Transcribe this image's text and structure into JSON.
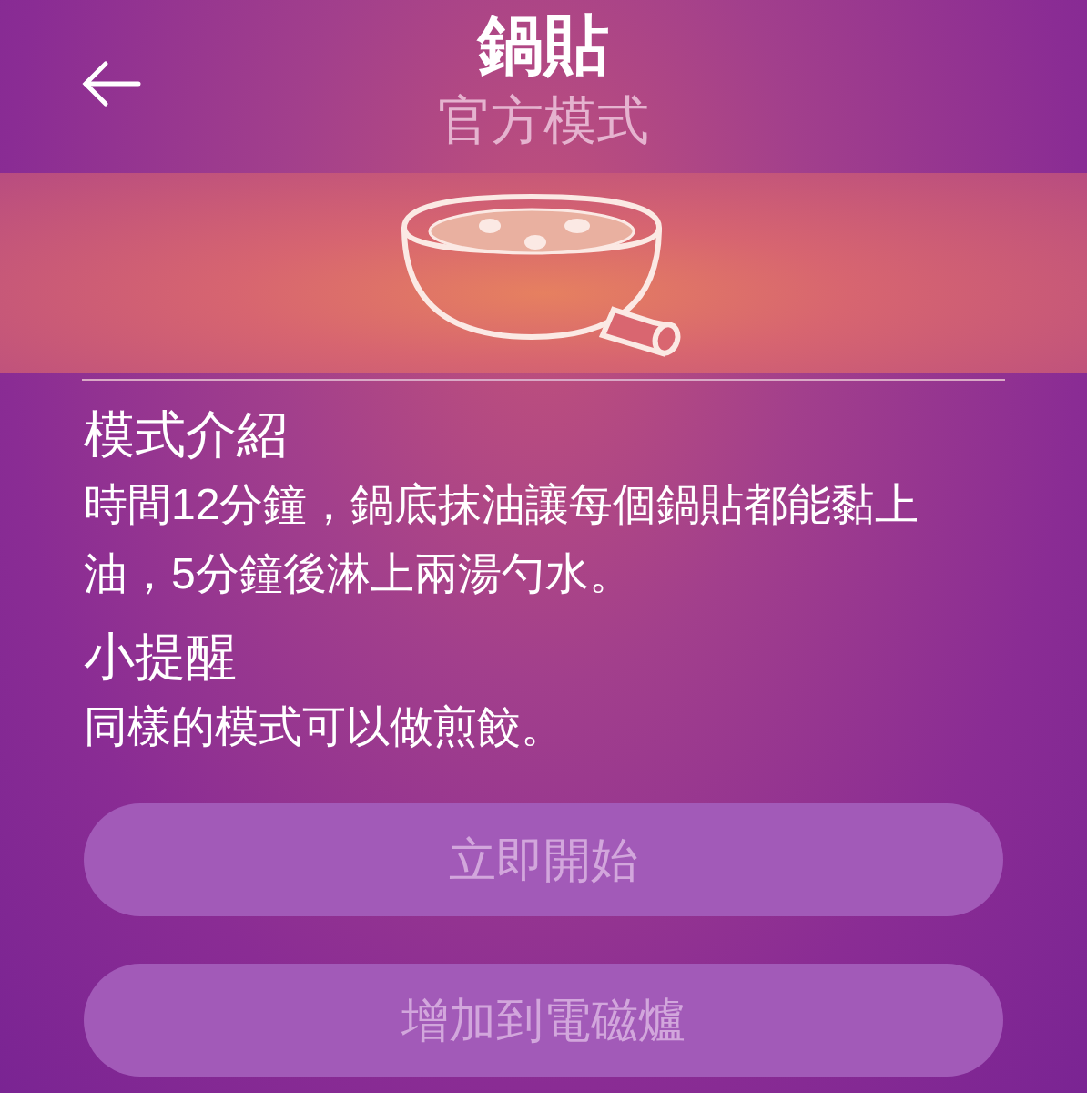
{
  "header": {
    "title": "鍋貼",
    "subtitle": "官方模式"
  },
  "sections": [
    {
      "heading": "模式介紹",
      "body": "時間12分鐘，鍋底抹油讓每個鍋貼都能黏上油，5分鐘後淋上兩湯勺水。"
    },
    {
      "heading": "小提醒",
      "body": "同樣的模式可以做煎餃。"
    }
  ],
  "buttons": [
    {
      "label": "立即開始",
      "disabled": true
    },
    {
      "label": "增加到電磁爐",
      "disabled": true
    }
  ]
}
